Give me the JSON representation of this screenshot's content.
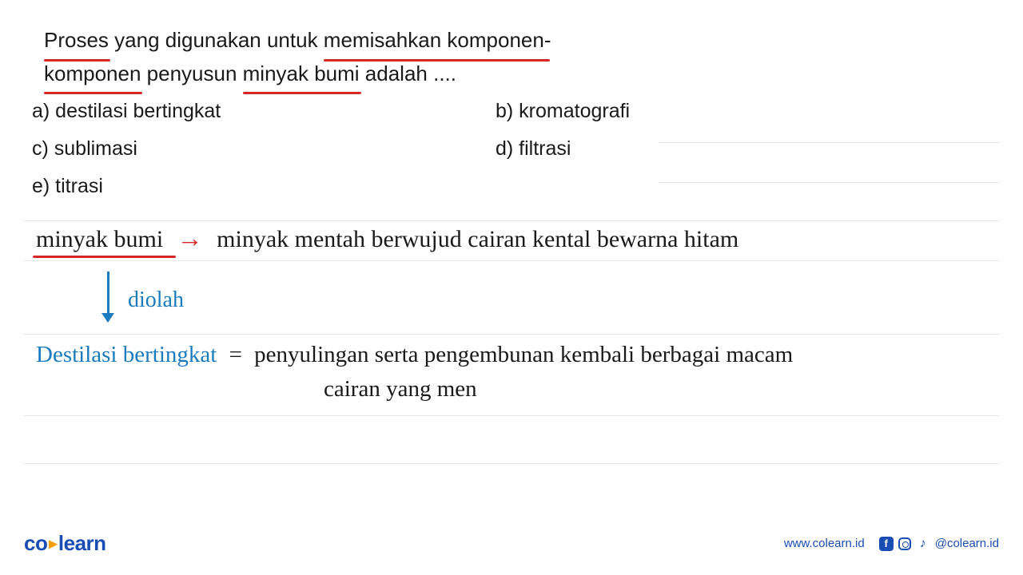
{
  "question": {
    "line1_a": "Proses",
    "line1_b": " yang digunakan untuk ",
    "line1_c": "memisahkan komponen-",
    "line2_a": "komponen",
    "line2_b": " penyusun ",
    "line2_c": "minyak bumi",
    "line2_d": " adalah ...."
  },
  "options": {
    "a": "a)  destilasi bertingkat",
    "b": "b)  kromatografi",
    "c": "c)  sublimasi",
    "d": "d)  filtrasi",
    "e": "e)  titrasi"
  },
  "handwriting": {
    "term1": "minyak bumi",
    "arrow": "→",
    "def1": "minyak mentah berwujud cairan kental bewarna hitam",
    "diolah": "diolah",
    "term2": "Destilasi bertingkat",
    "eq": "=",
    "def2a": "penyulingan serta pengembunan kembali berbagai macam",
    "def2b": "cairan yang men"
  },
  "footer": {
    "logo_a": "co",
    "logo_b": "learn",
    "url": "www.colearn.id",
    "handle": "@colearn.id"
  }
}
